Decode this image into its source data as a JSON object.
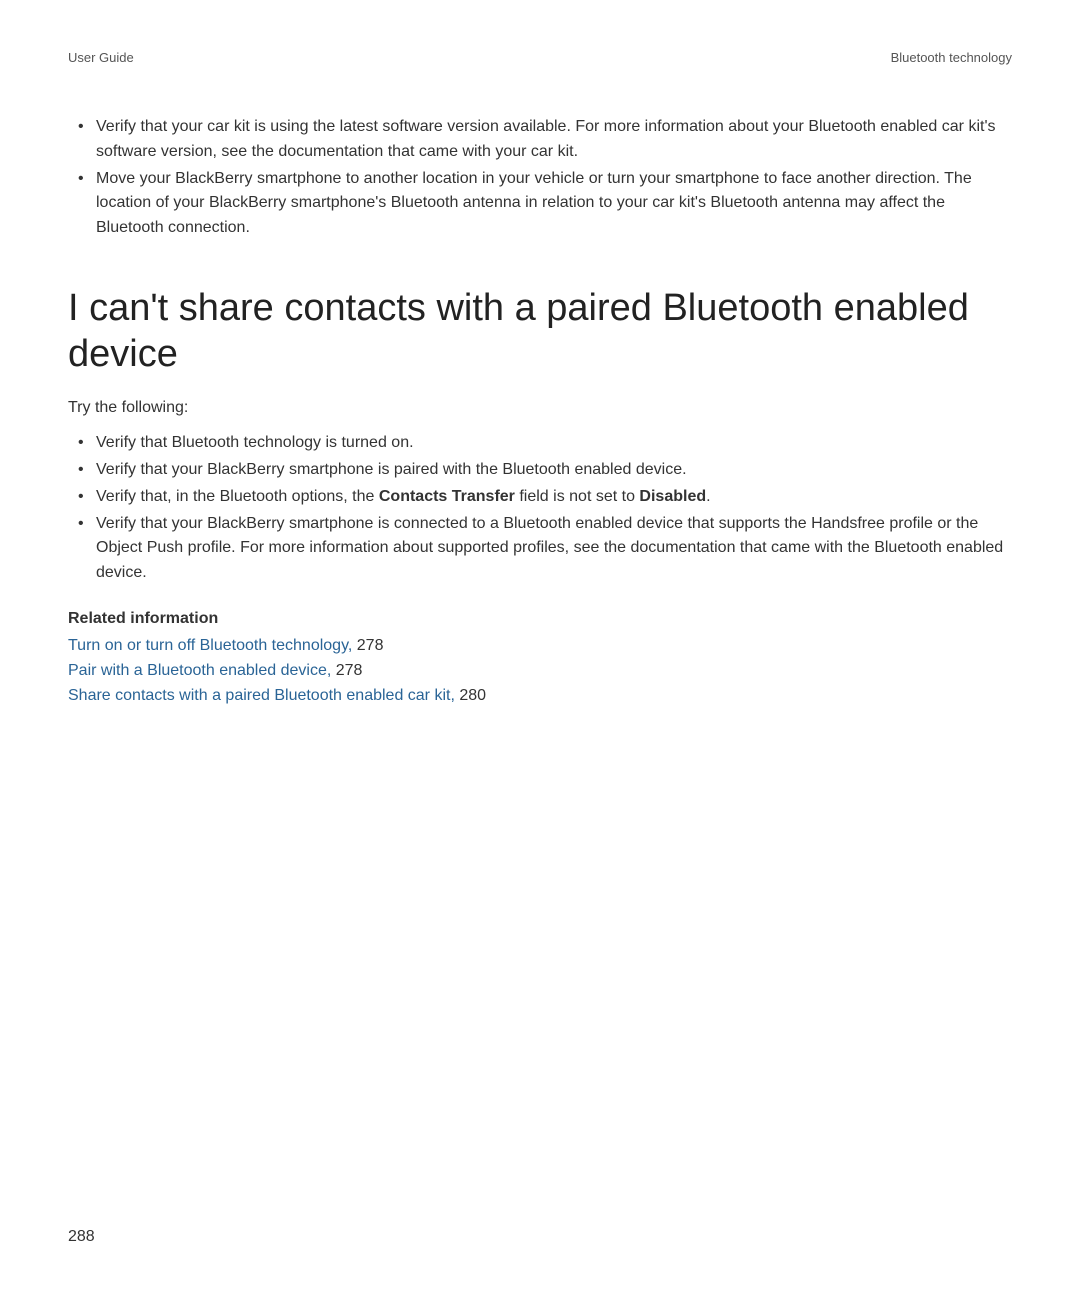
{
  "header": {
    "left": "User Guide",
    "right": "Bluetooth technology"
  },
  "topBullets": [
    "Verify that your car kit is using the latest software version available. For more information about your Bluetooth enabled car kit's software version, see the documentation that came with your car kit.",
    "Move your BlackBerry smartphone to another location in your vehicle or turn your smartphone to face another direction. The location of your BlackBerry smartphone's Bluetooth antenna in relation to your car kit's Bluetooth antenna may affect the Bluetooth connection."
  ],
  "heading": "I can't share contacts with a paired Bluetooth enabled device",
  "intro": "Try the following:",
  "steps": {
    "item1": "Verify that Bluetooth technology is turned on.",
    "item2": "Verify that your BlackBerry smartphone is paired with the Bluetooth enabled device.",
    "item3_pre": "Verify that, in the Bluetooth options, the ",
    "item3_bold1": "Contacts Transfer",
    "item3_mid": " field is not set to ",
    "item3_bold2": "Disabled",
    "item3_post": ".",
    "item4": "Verify that your BlackBerry smartphone is connected to a Bluetooth enabled device that supports the Handsfree profile or the Object Push profile. For more information about supported profiles, see the documentation that came with the Bluetooth enabled device."
  },
  "relatedHeading": "Related information",
  "relatedLinks": [
    {
      "text": "Turn on or turn off Bluetooth technology,",
      "page": "278"
    },
    {
      "text": "Pair with a Bluetooth enabled device,",
      "page": "278"
    },
    {
      "text": "Share contacts with a paired Bluetooth enabled car kit,",
      "page": "280"
    }
  ],
  "pageNumber": "288"
}
